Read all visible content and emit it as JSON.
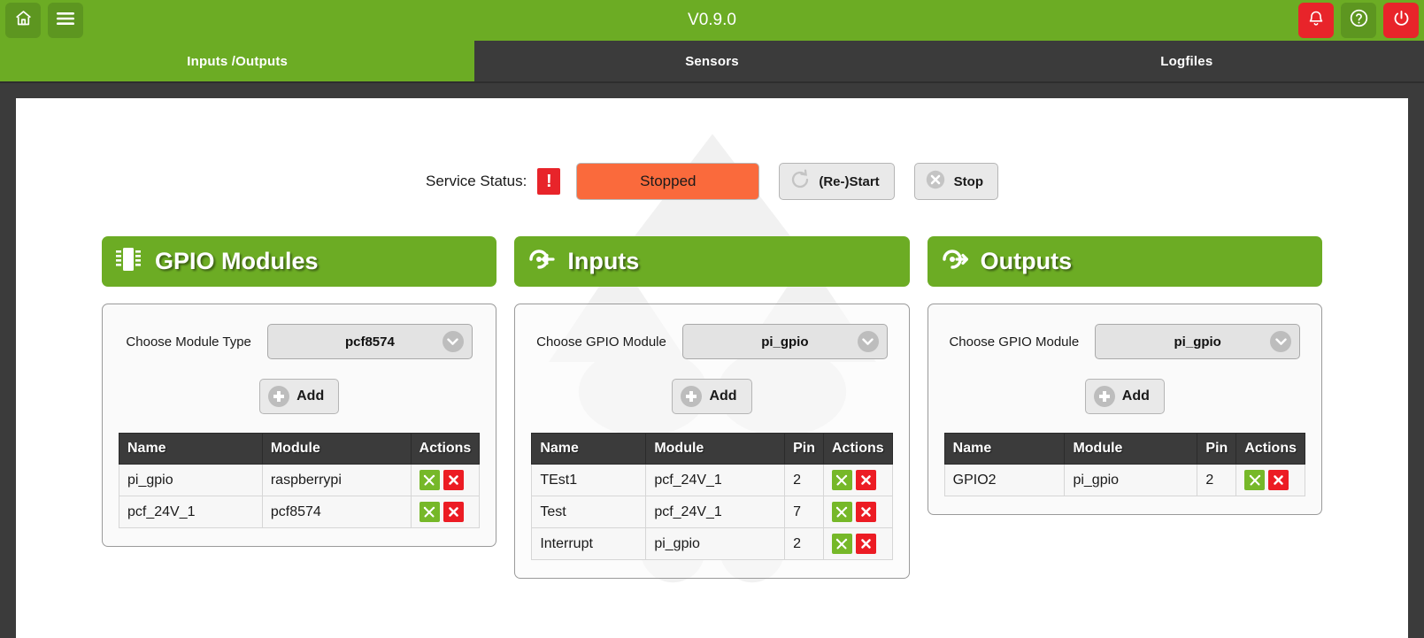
{
  "topbar": {
    "title": "V0.9.0",
    "home_icon": "home-icon",
    "menu_icon": "hamburger-menu-icon",
    "bell_icon": "bell-icon",
    "help_icon": "help-circle-icon",
    "power_icon": "power-icon",
    "green": "#6cac24",
    "red": "#e8242a"
  },
  "tabs": [
    {
      "label": "Inputs /Outputs",
      "active": true
    },
    {
      "label": "Sensors",
      "active": false
    },
    {
      "label": "Logfiles",
      "active": false
    }
  ],
  "service": {
    "label": "Service Status:",
    "alert_glyph": "!",
    "status_text": "Stopped",
    "status_color": "#fa6a3c",
    "restart_label": "(Re-)Start",
    "stop_label": "Stop",
    "restart_icon": "refresh-circle-icon",
    "stop_icon": "x-circle-icon"
  },
  "panels": [
    {
      "title": "GPIO Modules",
      "icon": "chip-icon",
      "chooser_label": "Choose Module Type",
      "selected": "pcf8574",
      "add_label": "Add",
      "columns": [
        "Name",
        "Module",
        "Actions"
      ],
      "has_pin": false,
      "rows": [
        {
          "name": "pi_gpio",
          "module": "raspberrypi"
        },
        {
          "name": "pcf_24V_1",
          "module": "pcf8574"
        }
      ]
    },
    {
      "title": "Inputs",
      "icon": "arrow-into-circle-icon",
      "chooser_label": "Choose GPIO Module",
      "selected": "pi_gpio",
      "add_label": "Add",
      "columns": [
        "Name",
        "Module",
        "Pin",
        "Actions"
      ],
      "has_pin": true,
      "rows": [
        {
          "name": "TEst1",
          "module": "pcf_24V_1",
          "pin": "2"
        },
        {
          "name": "Test",
          "module": "pcf_24V_1",
          "pin": "7"
        },
        {
          "name": "Interrupt",
          "module": "pi_gpio",
          "pin": "2"
        }
      ]
    },
    {
      "title": "Outputs",
      "icon": "arrow-out-of-circle-icon",
      "chooser_label": "Choose GPIO Module",
      "selected": "pi_gpio",
      "add_label": "Add",
      "columns": [
        "Name",
        "Module",
        "Pin",
        "Actions"
      ],
      "has_pin": true,
      "rows": [
        {
          "name": "GPIO2",
          "module": "pi_gpio",
          "pin": "2"
        }
      ]
    }
  ],
  "action_icons": {
    "edit": "tools-icon",
    "delete": "delete-x-icon",
    "edit_color": "#76b829",
    "delete_color": "#ec1c24"
  }
}
